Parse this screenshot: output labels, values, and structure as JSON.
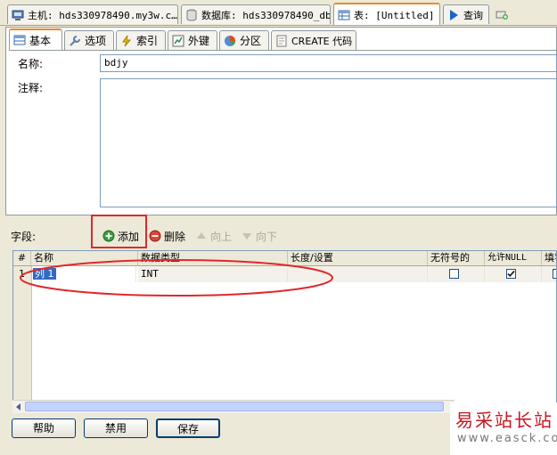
{
  "top_tabs": [
    {
      "label": "主机: hds330978490.my3w.c…",
      "icon": "server-icon"
    },
    {
      "label": "数据库: hds330978490_db",
      "icon": "database-icon"
    },
    {
      "label": "表: [Untitled]",
      "icon": "table-icon"
    },
    {
      "label": "查询",
      "icon": "play-icon"
    },
    {
      "label": "",
      "icon": "new-tab-icon"
    }
  ],
  "sub_tabs": [
    {
      "label": "基本",
      "icon": "grid-icon"
    },
    {
      "label": "选项",
      "icon": "wrench-icon"
    },
    {
      "label": "索引",
      "icon": "lightning-icon"
    },
    {
      "label": "外键",
      "icon": "foreign-key-icon"
    },
    {
      "label": "分区",
      "icon": "partition-icon"
    },
    {
      "label": "CREATE 代码",
      "icon": "code-icon"
    }
  ],
  "form": {
    "name_label": "名称:",
    "name_value": "bdjy",
    "comment_label": "注释:",
    "comment_value": ""
  },
  "fields_toolbar": {
    "label": "字段:",
    "add": "添加",
    "delete": "删除",
    "up": "向上",
    "down": "向下"
  },
  "grid": {
    "columns": [
      "#",
      "名称",
      "数据类型",
      "长度/设置",
      "无符号的",
      "允许NULL",
      "填零"
    ],
    "rows": [
      {
        "num": "1",
        "name": "列 1",
        "type": "INT",
        "length": "",
        "unsigned": false,
        "allow_null": true,
        "zerofill": false
      }
    ]
  },
  "buttons": {
    "help": "帮助",
    "discard": "禁用",
    "save": "保存"
  },
  "watermark": {
    "line1": "易采站长站",
    "line2": "www.easck.com"
  },
  "colors": {
    "highlight_red": "#e0282c",
    "active_tab": "#e68b2c",
    "selection": "#316ac5"
  }
}
